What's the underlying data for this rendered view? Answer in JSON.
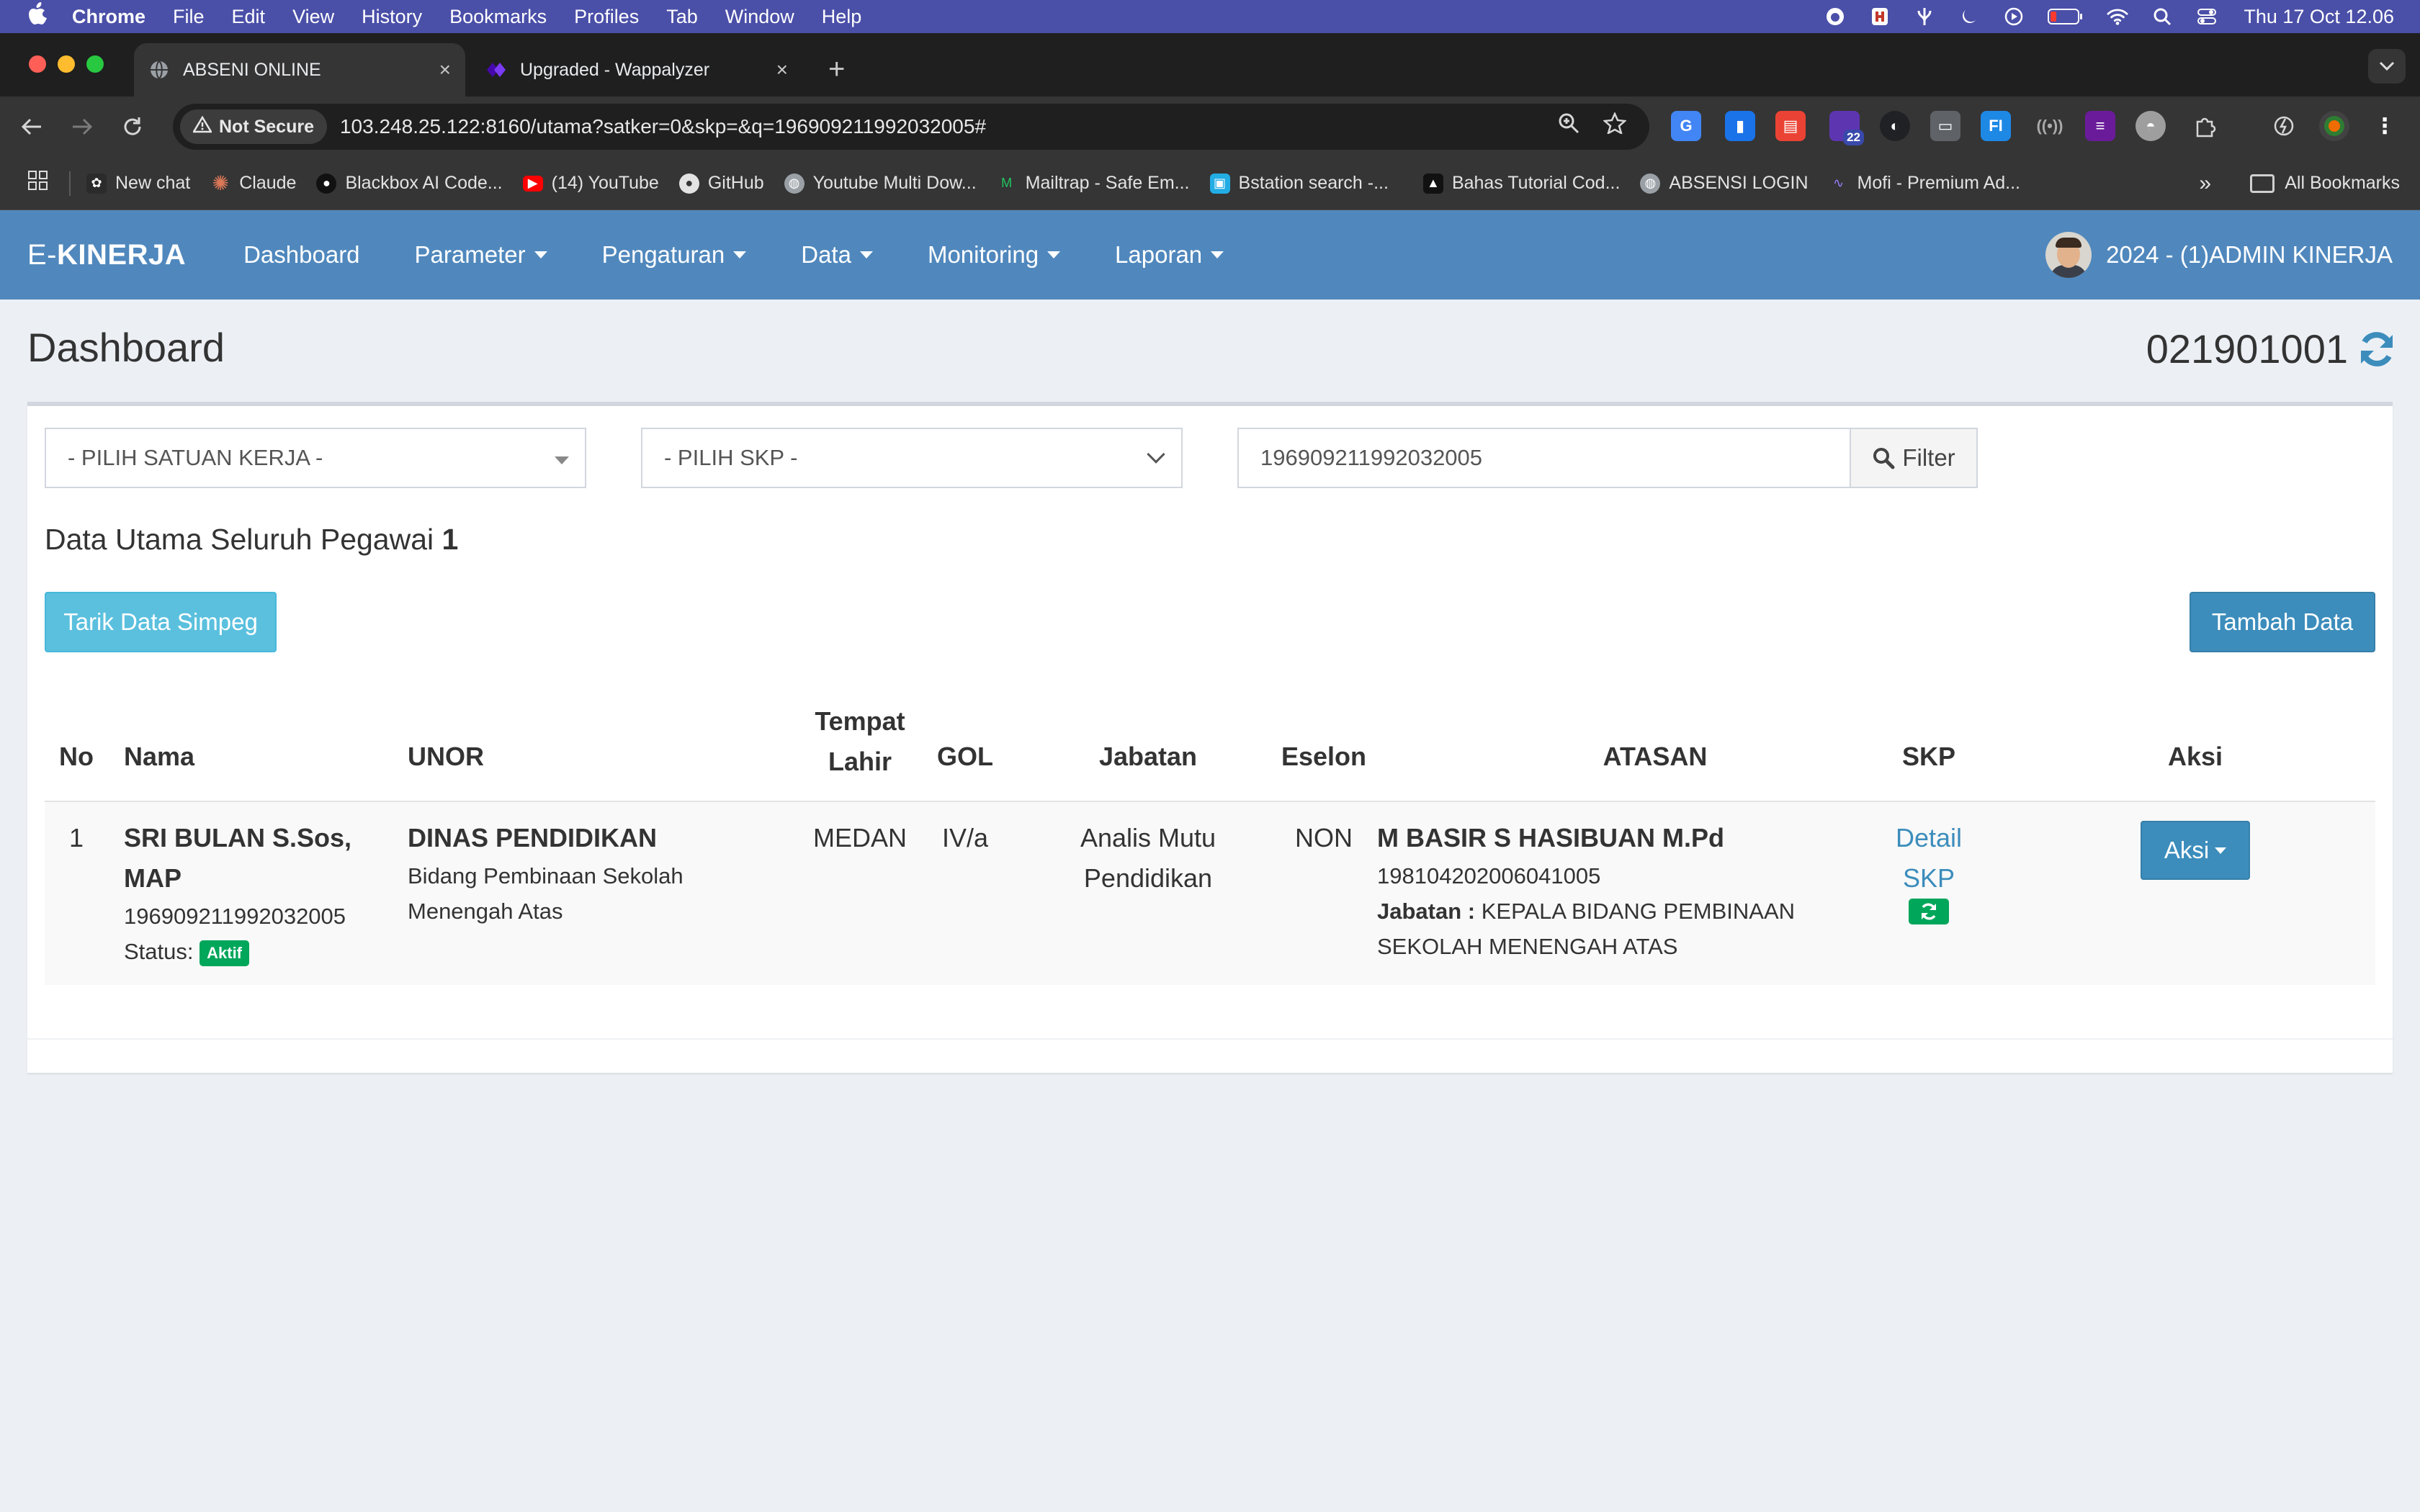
{
  "macos": {
    "menu": [
      "Chrome",
      "File",
      "Edit",
      "View",
      "History",
      "Bookmarks",
      "Profiles",
      "Tab",
      "Window",
      "Help"
    ],
    "clock": "Thu 17 Oct  12.06"
  },
  "browser": {
    "tabs": [
      {
        "title": "ABSENI ONLINE",
        "active": true
      },
      {
        "title": "Upgraded - Wappalyzer",
        "active": false
      }
    ],
    "security_label": "Not Secure",
    "url": "103.248.25.122:8160/utama?satker=0&skp=&q=196909211992032005#",
    "extension_badge": "22",
    "extension_fi": "FI",
    "bookmarks": [
      {
        "label": "New chat",
        "icon": "openai-icon",
        "color": "#2b2b2b"
      },
      {
        "label": "Claude",
        "icon": "claude-icon",
        "color": "#d97757"
      },
      {
        "label": "Blackbox AI Code...",
        "icon": "blackbox-icon",
        "color": "#111111"
      },
      {
        "label": "(14) YouTube",
        "icon": "youtube-icon",
        "color": "#ff0000"
      },
      {
        "label": "GitHub",
        "icon": "github-icon",
        "color": "#2b2b2b"
      },
      {
        "label": "Youtube Multi Dow...",
        "icon": "globe-icon",
        "color": "#5f6368"
      },
      {
        "label": "Mailtrap - Safe Em...",
        "icon": "mailtrap-icon",
        "color": "#22c55e"
      },
      {
        "label": "Bstation search -...",
        "icon": "bstation-icon",
        "color": "#23ade5"
      },
      {
        "label": "Bahas Tutorial Cod...",
        "icon": "bookmark-icon",
        "color": "#111111"
      },
      {
        "label": "ABSENSI LOGIN",
        "icon": "globe-icon",
        "color": "#5f6368"
      },
      {
        "label": "Mofi - Premium Ad...",
        "icon": "mofi-icon",
        "color": "#7c5cff"
      }
    ],
    "all_bookmarks": "All Bookmarks"
  },
  "app": {
    "brand_prefix": "E-",
    "brand_bold": "KINERJA",
    "nav": [
      "Dashboard",
      "Parameter",
      "Pengaturan",
      "Data",
      "Monitoring",
      "Laporan"
    ],
    "user": "2024 - (1)ADMIN KINERJA",
    "accent": "#5088bd"
  },
  "page": {
    "title": "Dashboard",
    "code": "021901001"
  },
  "filters": {
    "satker_selected": "- PILIH SATUAN KERJA -",
    "skp_selected": "- PILIH SKP -",
    "search_value": "196909211992032005",
    "filter_label": "Filter"
  },
  "summary": {
    "label": "Data Utama Seluruh Pegawai",
    "count": "1"
  },
  "buttons": {
    "tarik": "Tarik Data Simpeg",
    "tambah": "Tambah Data"
  },
  "table": {
    "headers": {
      "no": "No",
      "nama": "Nama",
      "unor": "UNOR",
      "tempat_1": "Tempat",
      "tempat_2": "Lahir",
      "gol": "GOL",
      "jabatan": "Jabatan",
      "eselon": "Eselon",
      "atasan": "ATASAN",
      "skp": "SKP",
      "aksi": "Aksi"
    },
    "rows": [
      {
        "no": "1",
        "nama_1": "SRI BULAN S.Sos,",
        "nama_2": "MAP",
        "nip": "196909211992032005",
        "status_label": "Status:",
        "status": "Aktif",
        "unor": "DINAS PENDIDIKAN",
        "unor_sub_1": "Bidang Pembinaan Sekolah",
        "unor_sub_2": "Menengah Atas",
        "tempat_lahir": "MEDAN",
        "gol": "IV/a",
        "jabatan_1": "Analis Mutu",
        "jabatan_2": "Pendidikan",
        "eselon": "NON",
        "atasan_nama": "M BASIR S HASIBUAN M.Pd",
        "atasan_nip": "198104202006041005",
        "atasan_jabatan_label": "Jabatan :",
        "atasan_jabatan_1": "KEPALA BIDANG PEMBINAAN",
        "atasan_jabatan_2": "SEKOLAH MENENGAH ATAS",
        "skp_link_1": "Detail",
        "skp_link_2": "SKP",
        "aksi": "Aksi"
      }
    ]
  }
}
